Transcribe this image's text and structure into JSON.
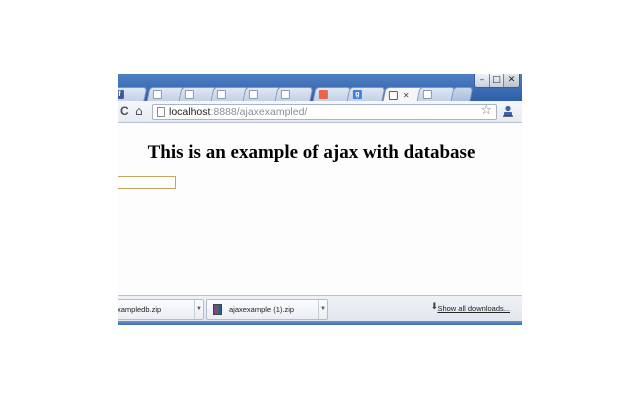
{
  "window": {
    "minimize_label": "–",
    "maximize_label": "□",
    "close_label": "✕"
  },
  "tabs": [
    {
      "favicon": "facebook-icon",
      "glyph": "f",
      "active": false
    },
    {
      "favicon": "page-icon",
      "glyph": "",
      "active": false
    },
    {
      "favicon": "page-icon",
      "glyph": "",
      "active": false
    },
    {
      "favicon": "page-icon",
      "glyph": "",
      "active": false
    },
    {
      "favicon": "page-icon",
      "glyph": "",
      "active": false
    },
    {
      "favicon": "page-icon",
      "glyph": "",
      "active": false
    },
    {
      "favicon": "mozilla-icon",
      "glyph": "",
      "active": false
    },
    {
      "favicon": "google-icon",
      "glyph": "g",
      "active": false
    },
    {
      "favicon": "chart-icon",
      "glyph": "",
      "active": true,
      "close": "✕"
    },
    {
      "favicon": "page-icon",
      "glyph": "",
      "active": false
    }
  ],
  "toolbar": {
    "reload_icon": "C",
    "home_icon": "⌂",
    "address_host": "localhost",
    "address_path": ":8888/ajaxexampled/",
    "star_icon": "☆"
  },
  "page": {
    "heading": "This is an example of ajax with database",
    "input_value": ""
  },
  "downloads": {
    "items": [
      {
        "name": "xampledb.zip"
      },
      {
        "name": "ajaxexample (1).zip"
      }
    ],
    "show_all": "Show all downloads..."
  }
}
